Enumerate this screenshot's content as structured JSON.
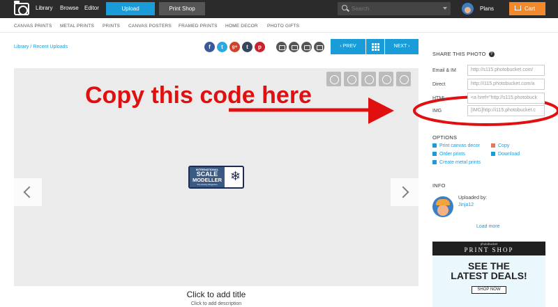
{
  "topbar": {
    "nav": [
      "Library",
      "Browse",
      "Editor"
    ],
    "upload_label": "Upload",
    "printshop_label": "Print Shop",
    "search_placeholder": "Search",
    "plans_label": "Plans",
    "cart_label": "Cart"
  },
  "categories": [
    "CANVAS PRINTS",
    "METAL PRINTS",
    "PRINTS",
    "CANVAS POSTERS",
    "FRAMED PRINTS",
    "HOME DECOR",
    "PHOTO GIFTS"
  ],
  "breadcrumb": {
    "root": "Library",
    "sep": "/",
    "current": "Recent Uploads"
  },
  "share_icons": [
    {
      "name": "facebook",
      "glyph": "f",
      "color": "#3b5998"
    },
    {
      "name": "twitter",
      "glyph": "t",
      "color": "#2aa9e0"
    },
    {
      "name": "google-plus",
      "glyph": "g+",
      "color": "#d0422a"
    },
    {
      "name": "tumblr",
      "glyph": "t",
      "color": "#36465d"
    },
    {
      "name": "pinterest",
      "glyph": "p",
      "color": "#c8232c"
    }
  ],
  "pager": {
    "prev": "‹ PREV",
    "next": "NEXT ›"
  },
  "image_logo": {
    "line1": "INTERNATIONAL",
    "line2": "SCALE",
    "line3": "MODELLER",
    "line4": "The Hobby Magazine"
  },
  "annotation": {
    "text": "Copy this code here",
    "color": "#e01010"
  },
  "photo": {
    "title": "Click to add title",
    "description": "Click to add description"
  },
  "share_photo": {
    "heading": "SHARE THIS PHOTO",
    "help": "?",
    "fields": [
      {
        "label": "Email & IM",
        "value": "http://s115.photobucket.com/"
      },
      {
        "label": "Direct",
        "value": "http://i115.photobucket.com/a"
      },
      {
        "label": "HTML",
        "value": "<a href=\"http://s115.photobuck"
      },
      {
        "label": "IMG",
        "value": "[IMG]http://i115.photobucket.c"
      }
    ]
  },
  "options": {
    "heading": "OPTIONS",
    "left": [
      "Print canvas decor",
      "Order prints",
      "Create metal prints"
    ],
    "right": [
      "Copy",
      "Download"
    ]
  },
  "info": {
    "heading": "INFO",
    "uploaded_by": "Uploaded by:",
    "user": "Jinja12",
    "load_more": "Load more"
  },
  "ad": {
    "brand": "photobucket",
    "title": "PRINT SHOP",
    "headline1": "SEE THE",
    "headline2": "LATEST DEALS!",
    "cta": "SHOP NOW"
  },
  "colors": {
    "accent": "#1a9cd8",
    "topbar": "#2b2b2b",
    "cart": "#f28a2c",
    "annotation": "#e01010"
  }
}
